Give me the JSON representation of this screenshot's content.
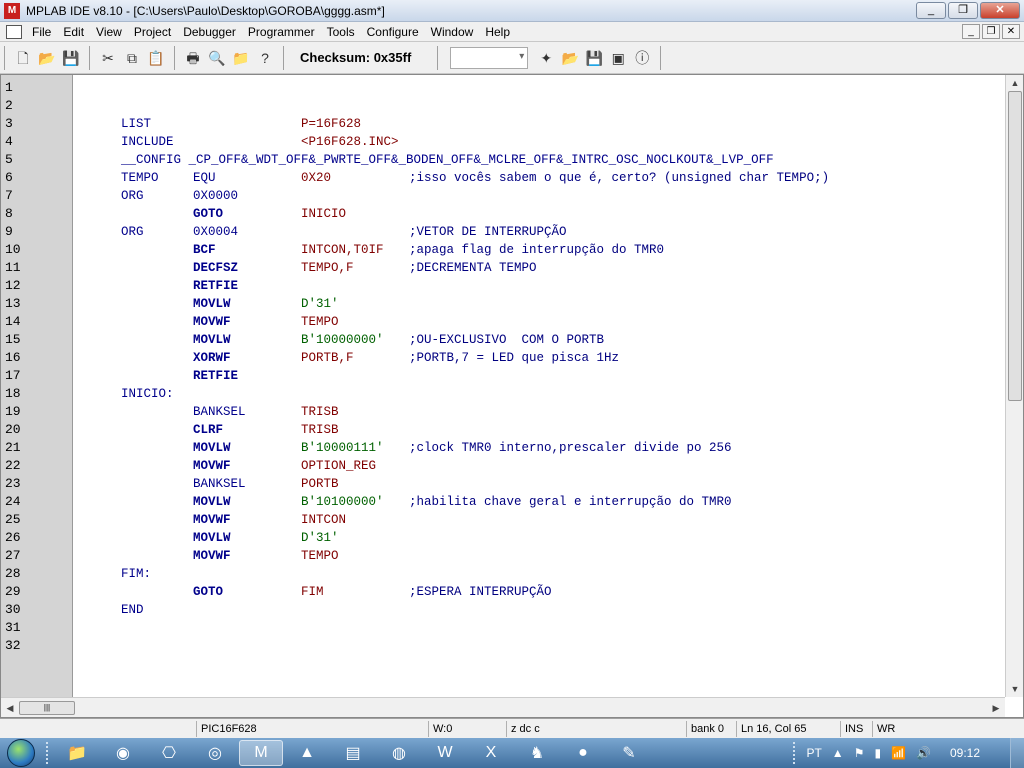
{
  "window": {
    "title": "MPLAB IDE v8.10 - [C:\\Users\\Paulo\\Desktop\\GOROBA\\gggg.asm*]",
    "minimize": "_",
    "maximize": "❐",
    "close": "✕"
  },
  "menu": [
    "File",
    "Edit",
    "View",
    "Project",
    "Debugger",
    "Programmer",
    "Tools",
    "Configure",
    "Window",
    "Help"
  ],
  "toolbar": {
    "checksum": "Checksum: 0x35ff",
    "combo_value": ""
  },
  "editor": {
    "line_numbers": [
      "1",
      "2",
      "3",
      "4",
      "5",
      "6",
      "7",
      "8",
      "9",
      "10",
      "11",
      "12",
      "13",
      "14",
      "15",
      "16",
      "17",
      "18",
      "19",
      "20",
      "21",
      "22",
      "23",
      "24",
      "25",
      "26",
      "27",
      "28",
      "29",
      "30",
      "31",
      "32"
    ],
    "lines": [
      {
        "c0": "",
        "c1": "",
        "c2": "",
        "c3": ""
      },
      {
        "c0": "",
        "c1": "",
        "c2": "",
        "c3": ""
      },
      {
        "c0": "LIST",
        "c1": "",
        "c2": "P=16F628",
        "c3": ""
      },
      {
        "c0": "INCLUDE",
        "c1": "",
        "c2": "<P16F628.INC>",
        "c3": ""
      },
      {
        "c0": "__CONFIG _CP_OFF&_WDT_OFF&_PWRTE_OFF&_BODEN_OFF&_MCLRE_OFF&_INTRC_OSC_NOCLKOUT&_LVP_OFF",
        "c1": "",
        "c2": "",
        "c3": ""
      },
      {
        "c0": "TEMPO",
        "c1": "EQU",
        "c2": "0X20",
        "c3": ";isso vocês sabem o que é, certo? (unsigned char TEMPO;)"
      },
      {
        "c0": "ORG",
        "c1": "0X0000",
        "c2": "",
        "c3": ""
      },
      {
        "c0": "",
        "c1": "GOTO",
        "c2": "INICIO",
        "c3": ""
      },
      {
        "c0": "ORG",
        "c1": "0X0004",
        "c2": "",
        "c3": ";VETOR DE INTERRUPÇÃO"
      },
      {
        "c0": "",
        "c1": "BCF",
        "c2": "INTCON,T0IF",
        "c3": ";apaga flag de interrupção do TMR0"
      },
      {
        "c0": "",
        "c1": "DECFSZ",
        "c2": "TEMPO,F",
        "c3": ";DECREMENTA TEMPO"
      },
      {
        "c0": "",
        "c1": "RETFIE",
        "c2": "",
        "c3": ""
      },
      {
        "c0": "",
        "c1": "MOVLW",
        "c2": "D'31'",
        "c3": ""
      },
      {
        "c0": "",
        "c1": "MOVWF",
        "c2": "TEMPO",
        "c3": ""
      },
      {
        "c0": "",
        "c1": "MOVLW",
        "c2": "B'10000000'",
        "c3": ";OU-EXCLUSIVO  COM O PORTB"
      },
      {
        "c0": "",
        "c1": "XORWF",
        "c2": "PORTB,F",
        "c3": ";PORTB,7 = LED que pisca 1Hz"
      },
      {
        "c0": "",
        "c1": "RETFIE",
        "c2": "",
        "c3": ""
      },
      {
        "c0": "INICIO:",
        "c1": "",
        "c2": "",
        "c3": ""
      },
      {
        "c0": "",
        "c1": "BANKSEL",
        "c2": "TRISB",
        "c3": ""
      },
      {
        "c0": "",
        "c1": "CLRF",
        "c2": "TRISB",
        "c3": ""
      },
      {
        "c0": "",
        "c1": "MOVLW",
        "c2": "B'10000111'",
        "c3": ";clock TMR0 interno,prescaler divide po 256"
      },
      {
        "c0": "",
        "c1": "MOVWF",
        "c2": "OPTION_REG",
        "c3": ""
      },
      {
        "c0": "",
        "c1": "BANKSEL",
        "c2": "PORTB",
        "c3": ""
      },
      {
        "c0": "",
        "c1": "MOVLW",
        "c2": "B'10100000'",
        "c3": ";habilita chave geral e interrupção do TMR0"
      },
      {
        "c0": "",
        "c1": "MOVWF",
        "c2": "INTCON",
        "c3": ""
      },
      {
        "c0": "",
        "c1": "MOVLW",
        "c2": "D'31'",
        "c3": ""
      },
      {
        "c0": "",
        "c1": "MOVWF",
        "c2": "TEMPO",
        "c3": ""
      },
      {
        "c0": "FIM:",
        "c1": "",
        "c2": "",
        "c3": ""
      },
      {
        "c0": "",
        "c1": "GOTO",
        "c2": "FIM",
        "c3": ";ESPERA INTERRUPÇÃO"
      },
      {
        "c0": "END",
        "c1": "",
        "c2": "",
        "c3": ""
      },
      {
        "c0": "",
        "c1": "",
        "c2": "",
        "c3": ""
      },
      {
        "c0": "",
        "c1": "",
        "c2": "",
        "c3": ""
      }
    ]
  },
  "statusbar": {
    "device": "PIC16F628",
    "w": "W:0",
    "flags": "z dc c",
    "bank": "bank 0",
    "position": "Ln 16, Col 65",
    "ins": "INS",
    "wr": "WR"
  },
  "taskbar": {
    "lang": "PT",
    "clock": "09:12"
  }
}
